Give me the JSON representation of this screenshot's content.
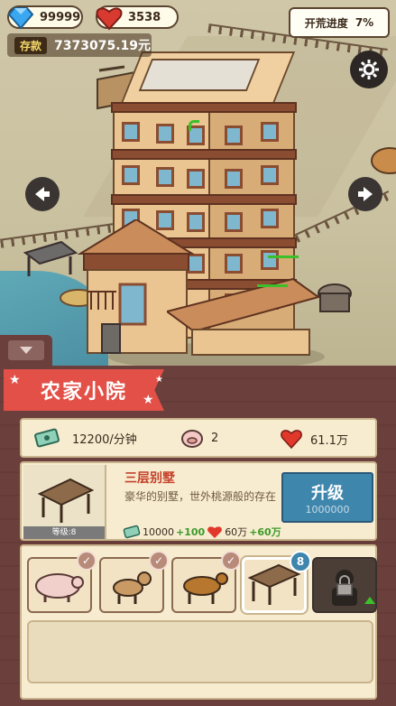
{
  "hud": {
    "diamonds": "99999",
    "hearts": "3538",
    "savings_label": "存款",
    "savings_value": "7373075.19元",
    "progress_label": "开荒进度",
    "progress_value": "7%"
  },
  "panel": {
    "title": "农家小院",
    "stats": {
      "income": "12200/分钟",
      "pigs": "2",
      "hearts": "61.1万"
    },
    "building": {
      "level": "等级:8",
      "name": "三层别墅",
      "description": "豪华的别墅，世外桃源般的存在",
      "cost_money": "10000",
      "cost_money_bonus": "+100",
      "cost_hearts": "60万",
      "cost_hearts_bonus": "+60万",
      "upgrade_label": "升级",
      "upgrade_cost": "1000000"
    },
    "slots": [
      {
        "icon": "pig-icon",
        "checked": true
      },
      {
        "icon": "dog-icon",
        "checked": true
      },
      {
        "icon": "cow-icon",
        "checked": true
      },
      {
        "icon": "shed-icon",
        "badge": "8"
      },
      {
        "icon": "locked-worker-icon",
        "locked": true
      }
    ]
  },
  "colors": {
    "banner": "#e25047",
    "upgrade": "#3f86ad",
    "panel_bg": "#6b3f3c",
    "card_bg": "#f7ecd0"
  }
}
